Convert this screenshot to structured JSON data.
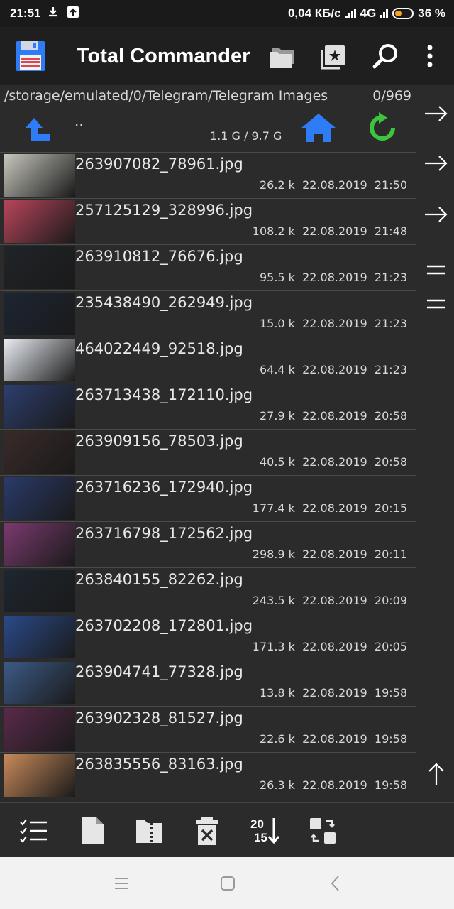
{
  "status": {
    "time": "21:51",
    "speed": "0,04 КБ/с",
    "network": "4G",
    "battery": "36 %"
  },
  "app": {
    "title": "Total Commander",
    "icons": [
      "save-icon",
      "folders-icon",
      "bookmark-icon",
      "search-icon",
      "more-icon"
    ]
  },
  "path": {
    "current": "/storage/emulated/0/Telegram/Telegram Images",
    "selection_count": "0/969",
    "parent": "..",
    "space": "1.1 G / 9.7 G"
  },
  "files": [
    {
      "name": "263907082_78961.jpg",
      "size": "26.2 k",
      "date": "22.08.2019",
      "time": "21:50",
      "thumb": "#c7c7bd"
    },
    {
      "name": "257125129_328996.jpg",
      "size": "108.2 k",
      "date": "22.08.2019",
      "time": "21:48",
      "thumb": "#b8455a"
    },
    {
      "name": "263910812_76676.jpg",
      "size": "95.5 k",
      "date": "22.08.2019",
      "time": "21:23",
      "thumb": "#202428"
    },
    {
      "name": "235438490_262949.jpg",
      "size": "15.0 k",
      "date": "22.08.2019",
      "time": "21:23",
      "thumb": "#1d2533"
    },
    {
      "name": "464022449_92518.jpg",
      "size": "64.4 k",
      "date": "22.08.2019",
      "time": "21:23",
      "thumb": "#e9eef4"
    },
    {
      "name": "263713438_172110.jpg",
      "size": "27.9 k",
      "date": "22.08.2019",
      "time": "20:58",
      "thumb": "#2d3e6e"
    },
    {
      "name": "263909156_78503.jpg",
      "size": "40.5 k",
      "date": "22.08.2019",
      "time": "20:58",
      "thumb": "#3a2a2a"
    },
    {
      "name": "263716236_172940.jpg",
      "size": "177.4 k",
      "date": "22.08.2019",
      "time": "20:15",
      "thumb": "#2a3a6a"
    },
    {
      "name": "263716798_172562.jpg",
      "size": "298.9 k",
      "date": "22.08.2019",
      "time": "20:11",
      "thumb": "#7a3a6e"
    },
    {
      "name": "263840155_82262.jpg",
      "size": "243.5 k",
      "date": "22.08.2019",
      "time": "20:09",
      "thumb": "#1e2630"
    },
    {
      "name": "263702208_172801.jpg",
      "size": "171.3 k",
      "date": "22.08.2019",
      "time": "20:05",
      "thumb": "#2a4a8a"
    },
    {
      "name": "263904741_77328.jpg",
      "size": "13.8 k",
      "date": "22.08.2019",
      "time": "19:58",
      "thumb": "#3c5a86"
    },
    {
      "name": "263902328_81527.jpg",
      "size": "22.6 k",
      "date": "22.08.2019",
      "time": "19:58",
      "thumb": "#5a2a4a"
    },
    {
      "name": "263835556_83163.jpg",
      "size": "26.3 k",
      "date": "22.08.2019",
      "time": "19:58",
      "thumb": "#c88a5a"
    }
  ],
  "colors": {
    "accent_blue": "#2f7df6",
    "refresh_green": "#3cc43c",
    "background": "#2b2b2b",
    "appbar": "#1f1f1f"
  }
}
